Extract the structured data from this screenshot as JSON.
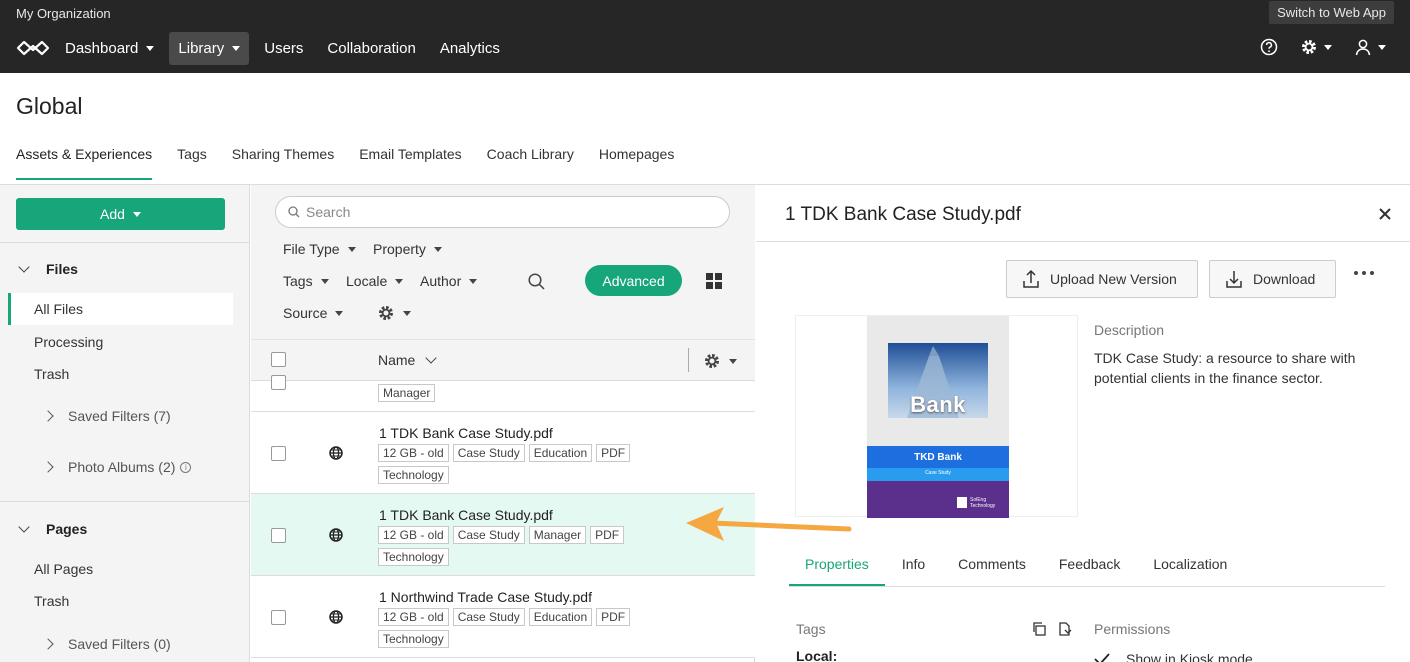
{
  "topbar": {
    "org_name": "My Organization",
    "switch_label": "Switch to Web App",
    "nav": [
      {
        "label": "Dashboard"
      },
      {
        "label": "Library"
      },
      {
        "label": "Users"
      },
      {
        "label": "Collaboration"
      },
      {
        "label": "Analytics"
      }
    ]
  },
  "page": {
    "title": "Global",
    "tabs": [
      {
        "label": "Assets & Experiences"
      },
      {
        "label": "Tags"
      },
      {
        "label": "Sharing Themes"
      },
      {
        "label": "Email Templates"
      },
      {
        "label": "Coach Library"
      },
      {
        "label": "Homepages"
      }
    ]
  },
  "sidebar": {
    "add_label": "Add",
    "files_label": "Files",
    "files_items": [
      {
        "label": "All Files"
      },
      {
        "label": "Processing"
      },
      {
        "label": "Trash"
      }
    ],
    "files_saved_filters": "Saved Filters (7)",
    "photo_albums": "Photo Albums (2)",
    "pages_label": "Pages",
    "pages_items": [
      {
        "label": "All Pages"
      },
      {
        "label": "Trash"
      }
    ],
    "pages_saved_filters": "Saved Filters (0)"
  },
  "filters": {
    "search_placeholder": "Search",
    "file_type": "File Type",
    "property": "Property",
    "tags": "Tags",
    "locale": "Locale",
    "author": "Author",
    "source": "Source",
    "advanced": "Advanced"
  },
  "list": {
    "name_header": "Name",
    "partial_tag": "Manager",
    "rows": [
      {
        "title": "1 TDK Bank Case Study.pdf",
        "tags": [
          "12 GB - old",
          "Case Study",
          "Education",
          "PDF",
          "Technology"
        ]
      },
      {
        "title": "1 TDK Bank Case Study.pdf",
        "tags": [
          "12 GB - old",
          "Case Study",
          "Manager",
          "PDF",
          "Technology"
        ]
      },
      {
        "title": "1 Northwind Trade Case Study.pdf",
        "tags": [
          "12 GB - old",
          "Case Study",
          "Education",
          "PDF",
          "Technology"
        ]
      }
    ]
  },
  "detail": {
    "title": "1 TDK Bank Case Study.pdf",
    "upload_label": "Upload New Version",
    "download_label": "Download",
    "thumb_bank_text": "Bank",
    "thumb_caption": "TKD Bank",
    "thumb_sub": "Case Study",
    "thumb_logo": "SolEng Technology",
    "description_label": "Description",
    "description_text": "TDK Case Study: a resource to share with potential clients in the finance sector.",
    "tabs": [
      {
        "label": "Properties"
      },
      {
        "label": "Info"
      },
      {
        "label": "Comments"
      },
      {
        "label": "Feedback"
      },
      {
        "label": "Localization"
      }
    ],
    "tags_label": "Tags",
    "local_label": "Local:",
    "permissions_label": "Permissions",
    "permission_item": "Show in Kiosk mode"
  },
  "colors": {
    "accent": "#17a57a",
    "topbar": "#262626",
    "selected_row": "#e3f9f2",
    "arrow": "#f5a742"
  }
}
